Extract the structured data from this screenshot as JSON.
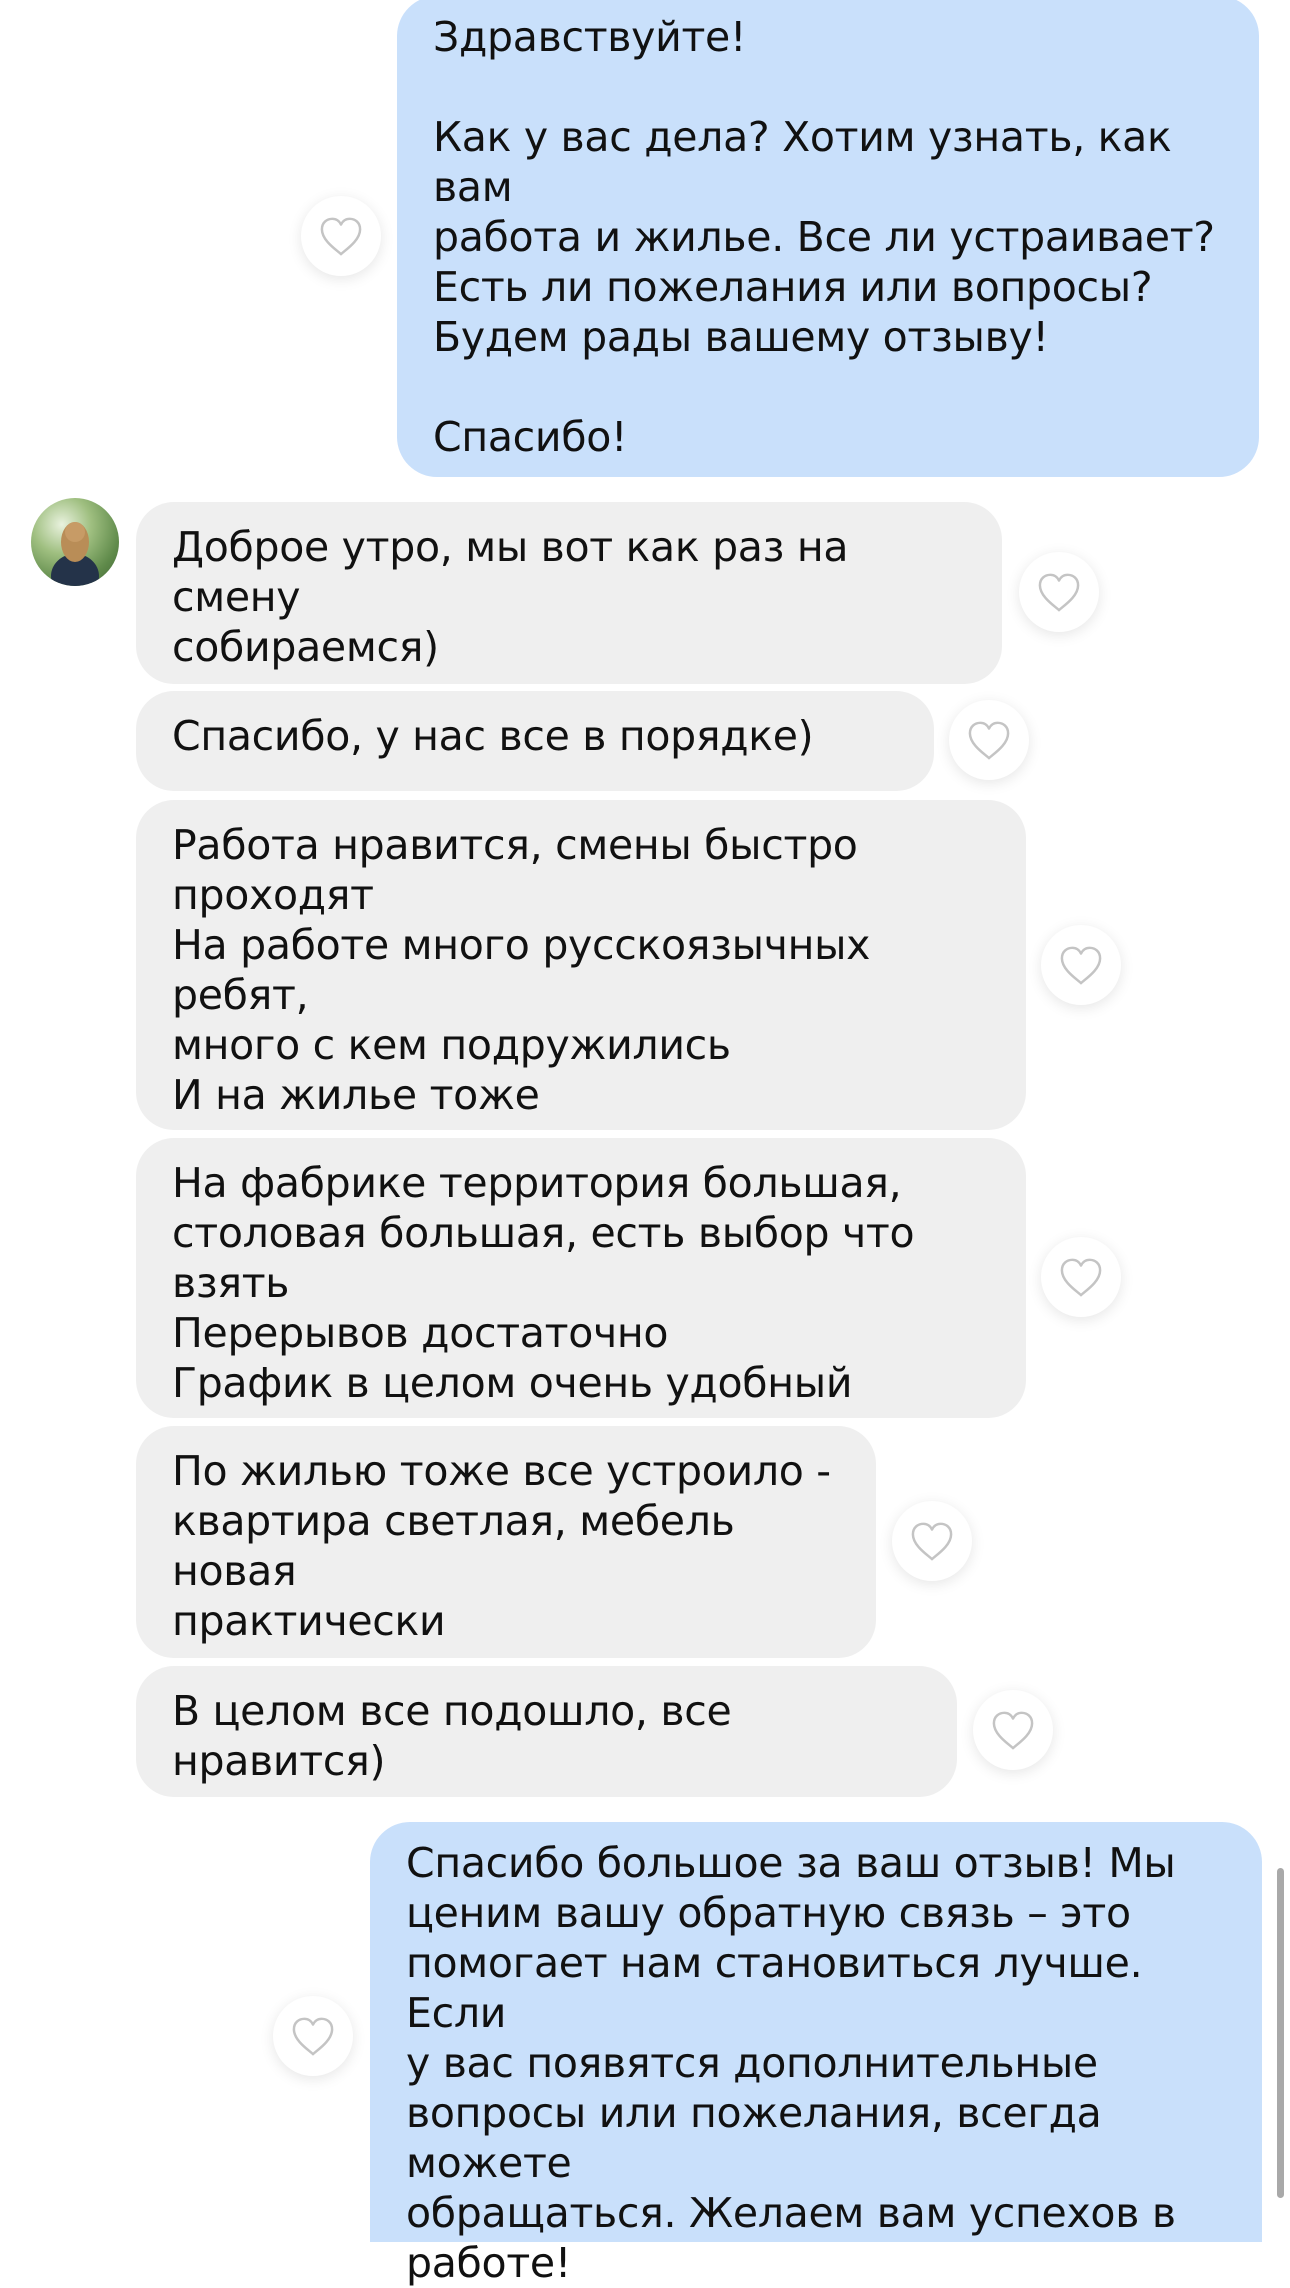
{
  "messages": [
    {
      "direction": "outgoing",
      "text": "Здравствуйте!\n\nКак у вас дела? Хотим узнать, как вам\nработа и жилье. Все ли устраивает?\nЕсть ли пожелания или вопросы?\nБудем рады вашему отзыву!\n\nСпасибо!"
    },
    {
      "direction": "incoming",
      "text": "Доброе утро, мы вот как раз на смену\nсобираемся)"
    },
    {
      "direction": "incoming",
      "text": "Спасибо, у нас все в порядке)"
    },
    {
      "direction": "incoming",
      "text": "Работа нравится, смены быстро\nпроходят\nНа работе много русскоязычных ребят,\nмного с кем подружились\nИ на жилье тоже"
    },
    {
      "direction": "incoming",
      "text": "На фабрике территория большая,\nстоловая большая, есть выбор что взять\nПерерывов достаточно\nГрафик в целом очень удобный"
    },
    {
      "direction": "incoming",
      "text": "По жилью тоже все устроило -\nквартира светлая, мебель новая\nпрактически"
    },
    {
      "direction": "incoming",
      "text": "В целом все подошло, все нравится)"
    },
    {
      "direction": "outgoing",
      "text": "Спасибо большое за ваш отзыв! Мы\nценим вашу обратную связь – это\nпомогает нам становиться лучше. Если\nу вас появятся дополнительные\nвопросы или пожелания, всегда можете\nобращаться. Желаем вам успехов в\nработе!"
    }
  ],
  "icons": {
    "like": "heart-outline-icon",
    "avatar": "user-avatar"
  },
  "colors": {
    "outgoing_bubble": "#c9e0fb",
    "incoming_bubble": "#efefef",
    "text": "#111111",
    "heart_stroke": "#c4c4c4"
  }
}
